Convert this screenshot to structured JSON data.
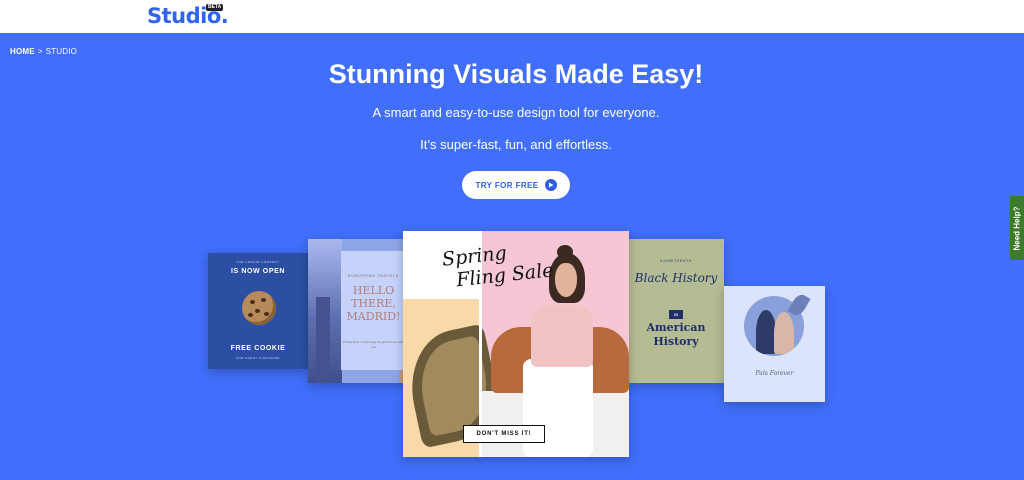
{
  "header": {
    "logo": "Studio.",
    "logo_badge": "BETA"
  },
  "breadcrumb": {
    "home": "HOME",
    "separator": ">",
    "current": "STUDIO"
  },
  "hero": {
    "title": "Stunning Visuals Made Easy!",
    "subtitle_1": "A smart and easy-to-use design tool for everyone.",
    "subtitle_2": "It’s super-fast, fun, and effortless.",
    "cta_label": "TRY FOR FREE",
    "cta_icon": "play-icon",
    "background_color": "#416ffb"
  },
  "cards": {
    "cookie": {
      "company": "THE COOKIE COMPANY",
      "headline": "IS NOW OPEN",
      "offer": "FREE COOKIE",
      "subtext": "FOR EVERY PURCHASE"
    },
    "madrid": {
      "eyebrow": "EUROPEAN TRAVELS",
      "headline": "HELLO THERE, MADRID!",
      "small": "Private Bed + Time Away Royal Reserve Add-ons"
    },
    "sale": {
      "headline_line1": "Spring",
      "headline_line2": "Fling Sale",
      "button": "DON'T MISS IT!"
    },
    "history": {
      "eyebrow": "#JUNETEENTH",
      "line1": "Black History",
      "is": "IS",
      "line2": "American History"
    },
    "photo": {
      "script": "Pals Forever"
    }
  },
  "help_tab": {
    "label": "Need Help?",
    "color": "#3c7a2e"
  }
}
